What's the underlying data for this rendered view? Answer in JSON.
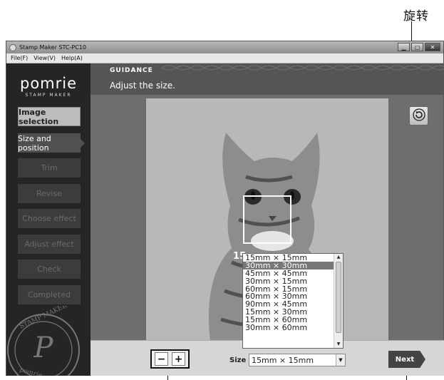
{
  "annotation": {
    "rotate_label": "旋转"
  },
  "window": {
    "title": "Stamp Maker STC-PC10",
    "menu": [
      "File(F)",
      "View(V)",
      "Help(A)"
    ]
  },
  "logo": {
    "main": "pomrie",
    "sub": "STAMP MAKER"
  },
  "steps": [
    "Image selection",
    "Size and position",
    "Trim",
    "Revise",
    "Choose effect",
    "Adjust effect",
    "Check",
    "Completed"
  ],
  "guidance": {
    "title": "GUIDANCE",
    "text": "Adjust the size."
  },
  "canvas": {
    "size_overlay": "15"
  },
  "bottom": {
    "zoom_out": "−",
    "zoom_in": "+",
    "size_label": "Size :",
    "size_value": "15mm × 15mm",
    "next_label": "Next"
  },
  "dropdown_options": [
    "15mm × 15mm",
    "30mm × 30mm",
    "45mm × 45mm",
    "30mm × 15mm",
    "60mm × 15mm",
    "60mm × 30mm",
    "90mm × 45mm",
    "15mm × 30mm",
    "15mm × 60mm",
    "30mm × 60mm"
  ],
  "stamp_logo": {
    "text_top": "STAMP MAKER",
    "text_bottom": "pomrie",
    "letter": "P"
  }
}
